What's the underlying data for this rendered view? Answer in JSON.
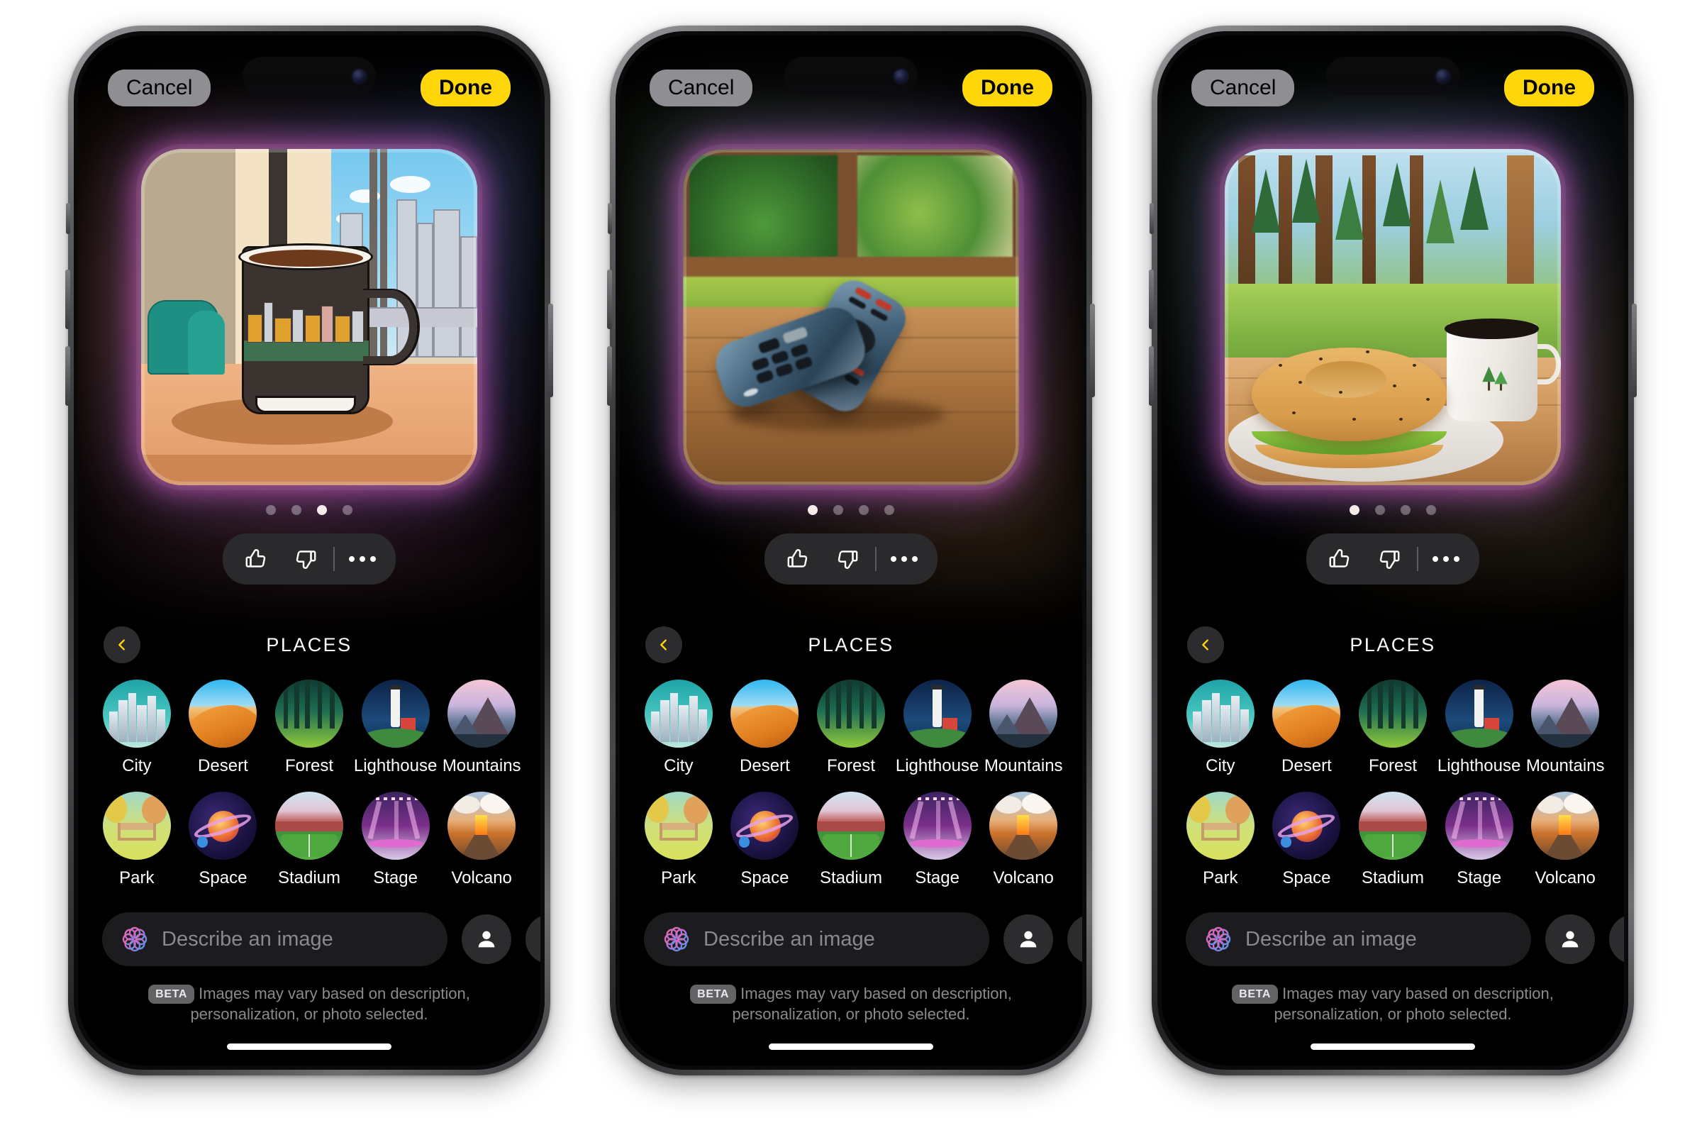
{
  "nav": {
    "cancel_label": "Cancel",
    "done_label": "Done",
    "back_icon": "chevron-left-icon",
    "section_title": "PLACES"
  },
  "reactions": {
    "thumbs_up_icon": "thumbs-up-icon",
    "thumbs_down_icon": "thumbs-down-icon",
    "more_icon": "ellipsis-icon"
  },
  "prompt": {
    "placeholder": "Describe an image",
    "value": "",
    "ai_icon": "apple-intelligence-icon",
    "person_icon": "person-icon",
    "add_icon": "plus-icon"
  },
  "footer": {
    "beta_label": "BETA",
    "disclaimer": "Images may vary based on description, personalization, or photo selected."
  },
  "categories": [
    {
      "label": "City",
      "icon": "city-thumbnail"
    },
    {
      "label": "Desert",
      "icon": "desert-thumbnail"
    },
    {
      "label": "Forest",
      "icon": "forest-thumbnail"
    },
    {
      "label": "Lighthouse",
      "icon": "lighthouse-thumbnail"
    },
    {
      "label": "Mountains",
      "icon": "mountains-thumbnail"
    },
    {
      "label": "Park",
      "icon": "park-thumbnail"
    },
    {
      "label": "Space",
      "icon": "space-thumbnail"
    },
    {
      "label": "Stadium",
      "icon": "stadium-thumbnail"
    },
    {
      "label": "Stage",
      "icon": "stage-thumbnail"
    },
    {
      "label": "Volcano",
      "icon": "volcano-thumbnail"
    }
  ],
  "phones": [
    {
      "id": "phone-1",
      "image_description": "Cartoon illustration of a dark coffee mug with a city skyline design on a wooden table beside a window overlooking skyscrapers",
      "page_dots_total": 4,
      "page_dots_active_index": 2
    },
    {
      "id": "phone-2",
      "image_description": "Photo-style image of two blue TV remote controls resting on a wooden table with a blurred green garden window behind",
      "page_dots_total": 4,
      "page_dots_active_index": 0
    },
    {
      "id": "phone-3",
      "image_description": "Illustration of a bagel sandwich on a white plate next to a white coffee mug with a pine tree design, on a wooden table in a sunlit forest clearing",
      "page_dots_total": 4,
      "page_dots_active_index": 0
    }
  ],
  "colors": {
    "accent_yellow": "#ffd60a",
    "cancel_gray": "#8e8e93",
    "surface": "#1c1c1e",
    "control": "#2c2c2e",
    "text_secondary": "#8a8a8e"
  }
}
